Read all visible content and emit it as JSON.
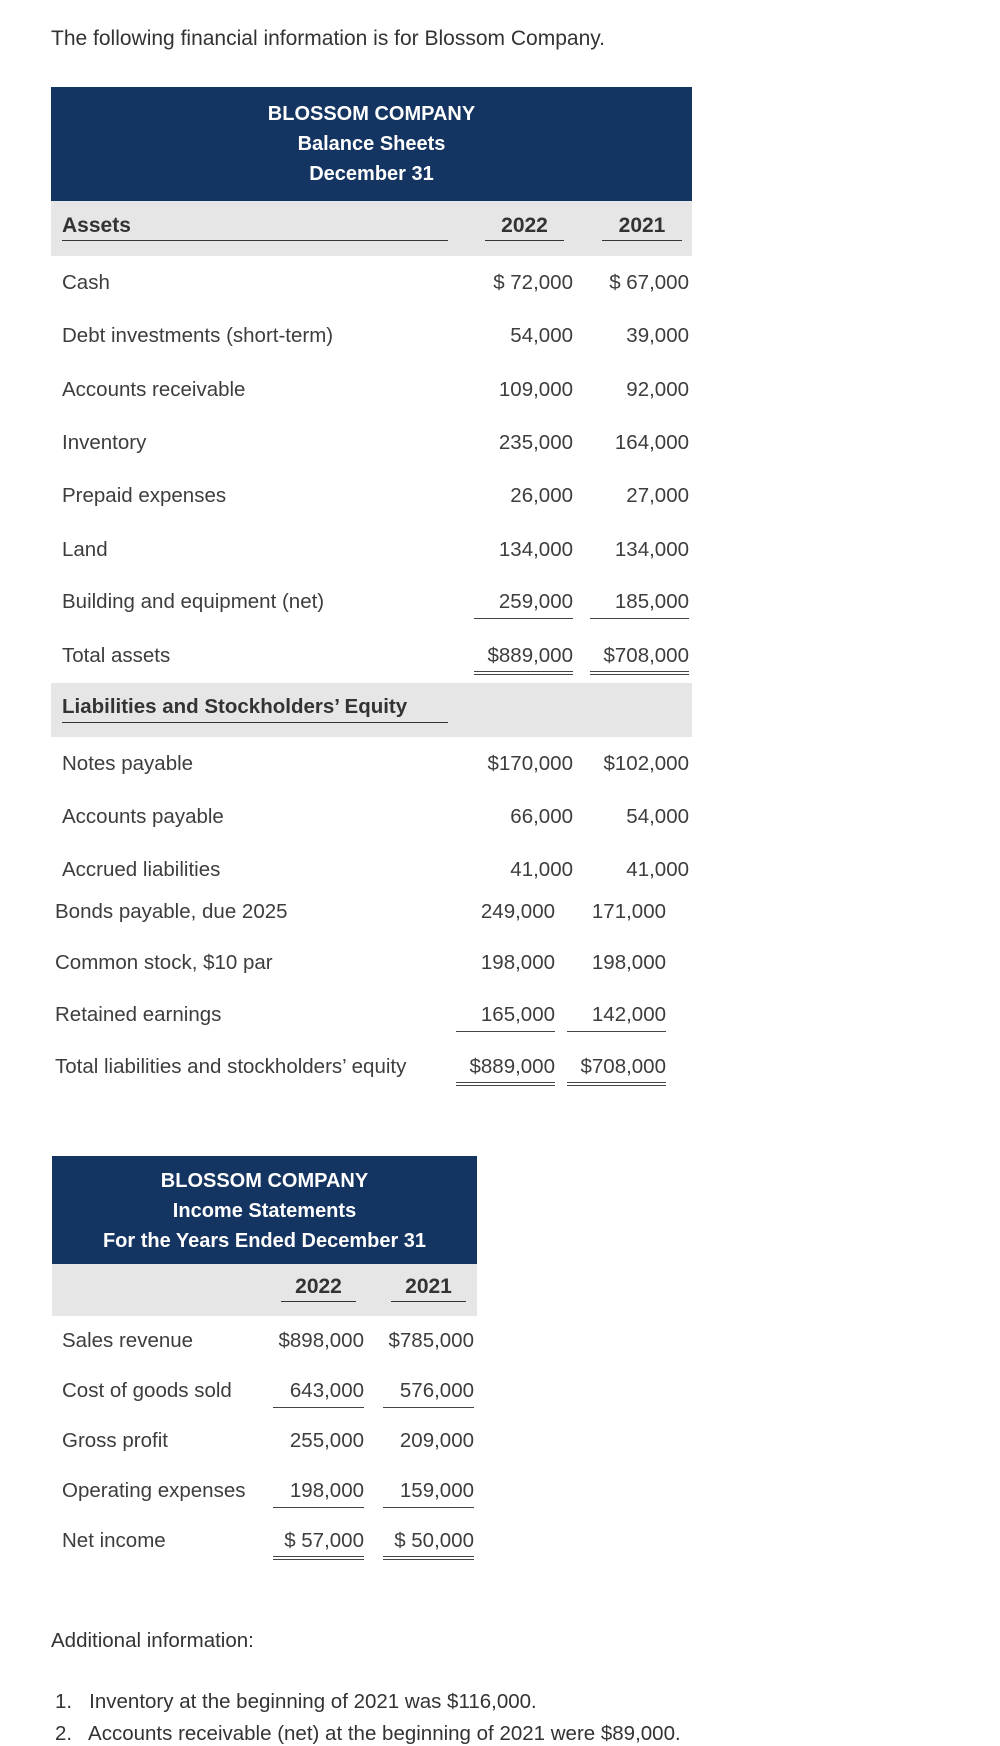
{
  "intro": "The following financial information is for Blossom Company.",
  "balance_sheet": {
    "title": [
      "BLOSSOM COMPANY",
      "Balance Sheets",
      "December 31"
    ],
    "assets_heading": "Assets",
    "years": [
      "2022",
      "2021"
    ],
    "assets": [
      {
        "label": "Cash",
        "v2022": "$ 72,000",
        "v2021": "$ 67,000"
      },
      {
        "label": "Debt investments (short-term)",
        "v2022": "54,000",
        "v2021": "39,000"
      },
      {
        "label": "Accounts receivable",
        "v2022": "109,000",
        "v2021": "92,000"
      },
      {
        "label": "Inventory",
        "v2022": "235,000",
        "v2021": "164,000"
      },
      {
        "label": "Prepaid expenses",
        "v2022": "26,000",
        "v2021": "27,000"
      },
      {
        "label": "Land",
        "v2022": "134,000",
        "v2021": "134,000"
      },
      {
        "label": "Building and equipment (net)",
        "v2022": "259,000",
        "v2021": "185,000"
      },
      {
        "label": "Total assets",
        "v2022": "$889,000",
        "v2021": "$708,000"
      }
    ],
    "liabilities_heading": "Liabilities and Stockholders’ Equity",
    "liabilities": [
      {
        "label": "Notes payable",
        "v2022": "$170,000",
        "v2021": "$102,000"
      },
      {
        "label": "Accounts payable",
        "v2022": "66,000",
        "v2021": "54,000"
      },
      {
        "label": "Accrued liabilities",
        "v2022": "41,000",
        "v2021": "41,000"
      },
      {
        "label": "Bonds payable, due 2025",
        "v2022": "249,000",
        "v2021": "171,000"
      },
      {
        "label": "Common stock, $10 par",
        "v2022": "198,000",
        "v2021": "198,000"
      },
      {
        "label": "Retained earnings",
        "v2022": "165,000",
        "v2021": "142,000"
      },
      {
        "label": "Total liabilities and stockholders’ equity",
        "v2022": "$889,000",
        "v2021": "$708,000"
      }
    ]
  },
  "income_statement": {
    "title": [
      "BLOSSOM COMPANY",
      "Income Statements",
      "For the Years Ended December 31"
    ],
    "years": [
      "2022",
      "2021"
    ],
    "rows": [
      {
        "label": "Sales revenue",
        "v2022": "$898,000",
        "v2021": "$785,000"
      },
      {
        "label": "Cost of goods sold",
        "v2022": "643,000",
        "v2021": "576,000"
      },
      {
        "label": "Gross profit",
        "v2022": "255,000",
        "v2021": "209,000"
      },
      {
        "label": "Operating expenses",
        "v2022": "198,000",
        "v2021": "159,000"
      },
      {
        "label": "Net income",
        "v2022": "$ 57,000",
        "v2021": "$ 50,000"
      }
    ]
  },
  "additional": {
    "heading": "Additional information:",
    "items": [
      "1.   Inventory at the beginning of 2021 was $116,000.",
      "2.   Accounts receivable (net) at the beginning of 2021 were $89,000."
    ]
  }
}
